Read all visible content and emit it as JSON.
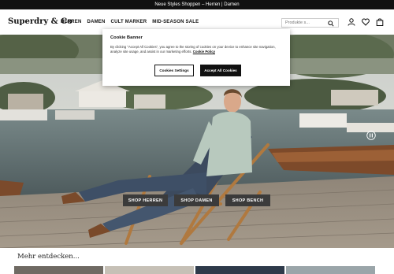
{
  "promo": {
    "text": "Neue Styles Shoppen – Herren | Damen"
  },
  "header": {
    "logo": "Superdry & Co",
    "nav": [
      "HERREN",
      "DAMEN",
      "CULT MARKER",
      "MID-SEASON SALE"
    ],
    "search_placeholder": "Produkte s...",
    "icons": [
      "search-icon",
      "account-icon",
      "wishlist-icon",
      "bag-icon"
    ]
  },
  "cookie": {
    "title": "Cookie Banner",
    "text": "By clicking \"Accept All Cookies\", you agree to the storing of cookies on your device to enhance site navigation, analyze site usage, and assist in our marketing efforts.",
    "link": "Cookie Policy",
    "settings_label": "Cookies Settings",
    "accept_label": "Accept All Cookies"
  },
  "hero": {
    "buttons": [
      "SHOP HERREN",
      "SHOP DAMEN",
      "SHOP BENCH"
    ],
    "pause_icon": "pause-icon"
  },
  "more": {
    "title": "Mehr entdecken..."
  },
  "colors": {
    "brand": "#111111",
    "promo_bg": "#111111",
    "button": "#3b3b3b"
  }
}
